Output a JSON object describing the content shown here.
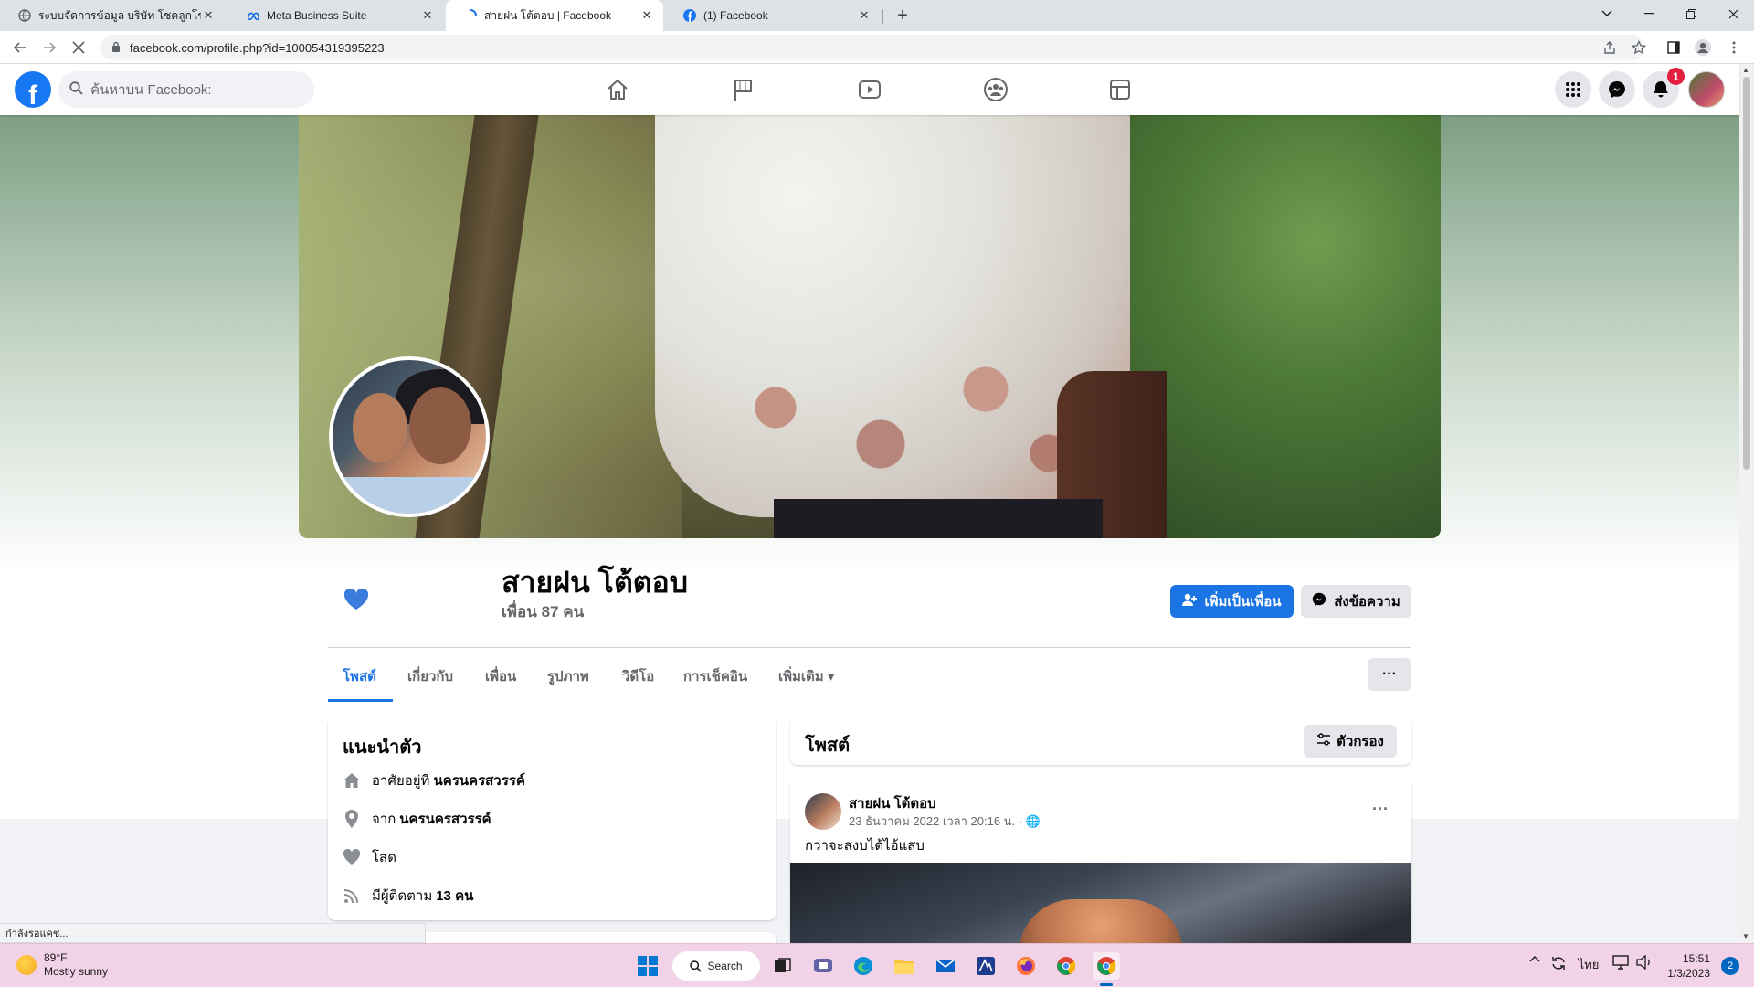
{
  "browser": {
    "tabs": [
      {
        "title": "ระบบจัดการข้อมูล บริษัท โชคลูกโชค ·",
        "active": false
      },
      {
        "title": "Meta Business Suite",
        "active": false
      },
      {
        "title": "สายฝน โต้ตอบ | Facebook",
        "active": true
      },
      {
        "title": "(1) Facebook",
        "active": false
      }
    ],
    "close_glyph": "✕",
    "new_tab_glyph": "+",
    "url": "facebook.com/profile.php?id=100054319395223",
    "status_text": "กำลังรอแคช..."
  },
  "fb": {
    "logo_letter": "f",
    "search_placeholder": "ค้นหาบน Facebook:",
    "nav_icons": [
      "home-icon",
      "pages-flag-icon",
      "watch-video-icon",
      "groups-icon",
      "gaming-icon"
    ],
    "notification_count": "1",
    "brand_color": "#1877f2"
  },
  "profile": {
    "name": "สายฝน โต้ตอบ",
    "friends": "เพื่อน 87 คน",
    "add_friend": "เพิ่มเป็นเพื่อน",
    "message": "ส่งข้อความ",
    "more_dots": "···",
    "tabs": [
      "โพสต์",
      "เกี่ยวกับ",
      "เพื่อน",
      "รูปภาพ",
      "วิดีโอ",
      "การเช็คอิน",
      "เพิ่มเติม ▾"
    ]
  },
  "intro": {
    "title": "แนะนำตัว",
    "lives_prefix": "อาศัยอยู่ที่",
    "lives_value": "นครนครสวรรค์",
    "from_prefix": "จาก",
    "from_value": "นครนครสวรรค์",
    "relationship": "โสด",
    "followers_prefix": "มีผู้ติดตาม",
    "followers_value": "13 คน"
  },
  "posts": {
    "title": "โพสต์",
    "filter": "ตัวกรอง",
    "items": [
      {
        "author": "สายฝน โต้ตอบ",
        "date": "23 ธันวาคม 2022 เวลา 20:16 น. · 🌐",
        "text": "กว่าจะสงบได้ไอ้แสบ",
        "menu": "···"
      }
    ]
  },
  "taskbar": {
    "weather_temp": "89°F",
    "weather_desc": "Mostly sunny",
    "search_label": "Search",
    "lang": "ไทย",
    "time": "15:51",
    "date": "1/3/2023",
    "notif_count": "2"
  }
}
